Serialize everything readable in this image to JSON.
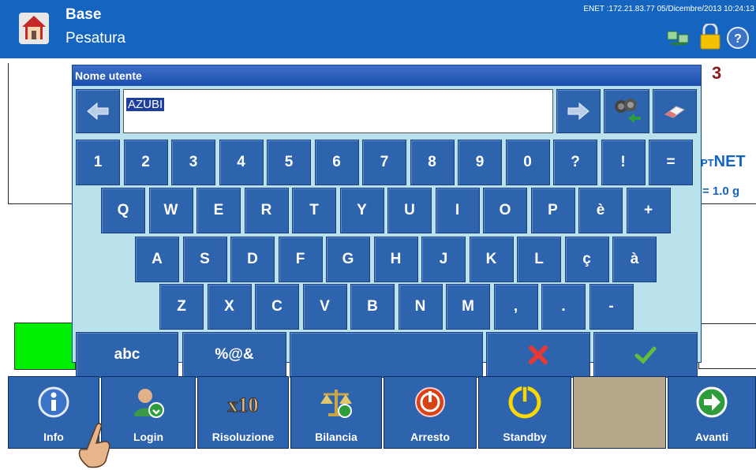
{
  "header": {
    "title": "Base",
    "subtitle": "Pesatura",
    "net_info": "ENET :172.21.83.77  05/Dicembre/2013 10:24:13",
    "icons": [
      "home-icon",
      "network-icon",
      "lock-icon",
      "help-icon"
    ]
  },
  "background": {
    "alarm_number": "3",
    "net_prefix": "PT",
    "net_label": "NET",
    "increment": "= 1.0 g"
  },
  "dialog": {
    "title": "Nome utente",
    "input_value": "AZUBI",
    "row1": [
      "1",
      "2",
      "3",
      "4",
      "5",
      "6",
      "7",
      "8",
      "9",
      "0",
      "?",
      "!",
      "="
    ],
    "row2": [
      "Q",
      "W",
      "E",
      "R",
      "T",
      "Y",
      "U",
      "I",
      "O",
      "P",
      "è",
      "+"
    ],
    "row3": [
      "A",
      "S",
      "D",
      "F",
      "G",
      "H",
      "J",
      "K",
      "L",
      "ç",
      "à"
    ],
    "row4": [
      "Z",
      "X",
      "C",
      "V",
      "B",
      "N",
      "M",
      ",",
      ".",
      "-"
    ],
    "mode_abc": "abc",
    "mode_sym": "%@&"
  },
  "bottom_bar": {
    "buttons": [
      {
        "label": "Info",
        "icon": "info-icon"
      },
      {
        "label": "Login",
        "icon": "login-user-icon"
      },
      {
        "label": "Risoluzione",
        "icon": "x10-icon"
      },
      {
        "label": "Bilancia",
        "icon": "scale-icon"
      },
      {
        "label": "Arresto",
        "icon": "shutdown-icon"
      },
      {
        "label": "Standby",
        "icon": "standby-icon"
      },
      {
        "label": "",
        "icon": ""
      },
      {
        "label": "Avanti",
        "icon": "forward-arrow-icon"
      }
    ]
  },
  "colors": {
    "header": "#1565c0",
    "key": "#2e63ad",
    "dialog_bg": "#b9e2ec",
    "accent_green": "#00ee00"
  }
}
